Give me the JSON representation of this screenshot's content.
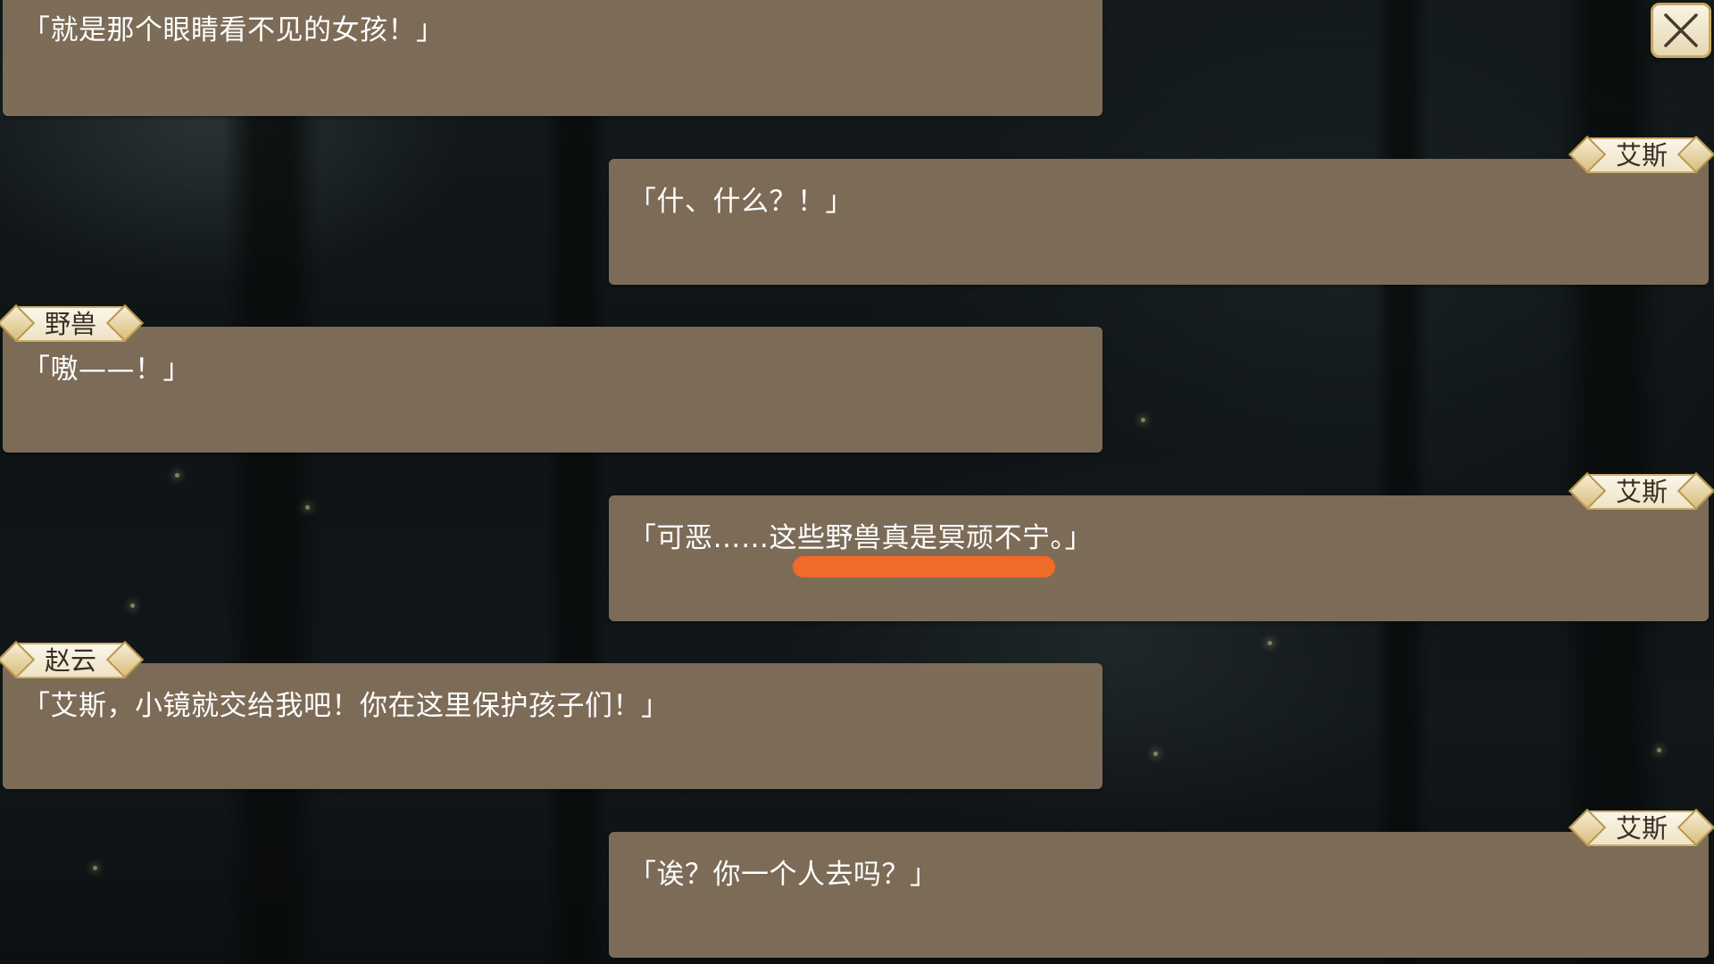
{
  "dialogue": [
    {
      "side": "left",
      "speaker": "",
      "text": "「就是那个眼睛看不见的女孩！」"
    },
    {
      "side": "right",
      "speaker": "艾斯",
      "text": "「什、什么？！」"
    },
    {
      "side": "left",
      "speaker": "野兽",
      "text": "「嗷——！」"
    },
    {
      "side": "right",
      "speaker": "艾斯",
      "text": "「可恶……这些野兽真是冥顽不宁。」"
    },
    {
      "side": "left",
      "speaker": "赵云",
      "text": "「艾斯，小镜就交给我吧！你在这里保护孩子们！」"
    },
    {
      "side": "right",
      "speaker": "艾斯",
      "text": "「诶？你一个人去吗？」"
    }
  ],
  "controls": {
    "close_icon": "close-icon"
  },
  "colors": {
    "bubble": "#806e5a",
    "nameplate": "#f3e9d2",
    "nameplate_border": "#c9ad6a",
    "highlight": "#f06a28",
    "text": "#ffffff"
  }
}
